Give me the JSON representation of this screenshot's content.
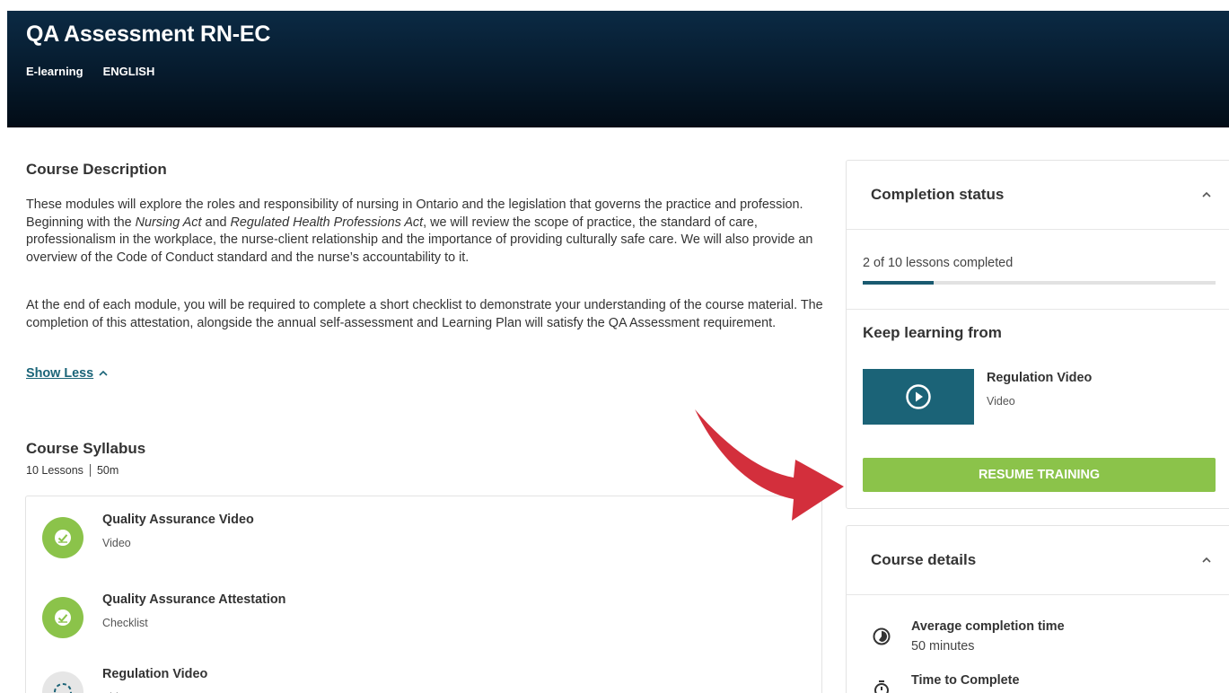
{
  "hero": {
    "title": "QA Assessment RN-EC",
    "type": "E-learning",
    "language": "ENGLISH"
  },
  "description": {
    "heading": "Course Description",
    "p1_a": "These modules will explore the roles and responsibility of nursing in Ontario and the legislation that governs the practice and profession. Beginning with the ",
    "p1_em1": "Nursing Act",
    "p1_b": " and ",
    "p1_em2": "Regulated Health Professions Act",
    "p1_c": ", we will review the scope of practice, the standard of care, professionalism in the workplace, the nurse-client relationship and the importance of providing culturally safe care. We will also provide an overview of the Code of Conduct standard and the nurse’s accountability to it.",
    "p2": "At the end of each module, you will be required to complete a short checklist to demonstrate your understanding of the course material. The completion of this attestation, alongside the annual self-assessment and Learning Plan will satisfy the QA Assessment requirement.",
    "toggle_label": "Show Less"
  },
  "syllabus": {
    "heading": "Course Syllabus",
    "lesson_count": "10 Lessons",
    "duration": "50m",
    "lessons": [
      {
        "name": "Quality Assurance Video",
        "type": "Video",
        "status": "completed"
      },
      {
        "name": "Quality Assurance Attestation",
        "type": "Checklist",
        "status": "completed"
      },
      {
        "name": "Regulation Video",
        "type": "Video",
        "status": "in-progress"
      }
    ]
  },
  "completion": {
    "heading": "Completion status",
    "progress_text": "2 of 10 lessons completed",
    "progress_fraction": 0.2,
    "keep_learning_heading": "Keep learning from",
    "current_lesson_name": "Regulation Video",
    "current_lesson_type": "Video",
    "resume_label": "RESUME TRAINING"
  },
  "details": {
    "heading": "Course details",
    "avg_time_label": "Average completion time",
    "avg_time_value": "50 minutes",
    "time_to_complete_label": "Time to Complete"
  },
  "colors": {
    "accent_green": "#8bc34a",
    "accent_teal": "#1b6377",
    "arrow_red": "#d32f3c"
  }
}
